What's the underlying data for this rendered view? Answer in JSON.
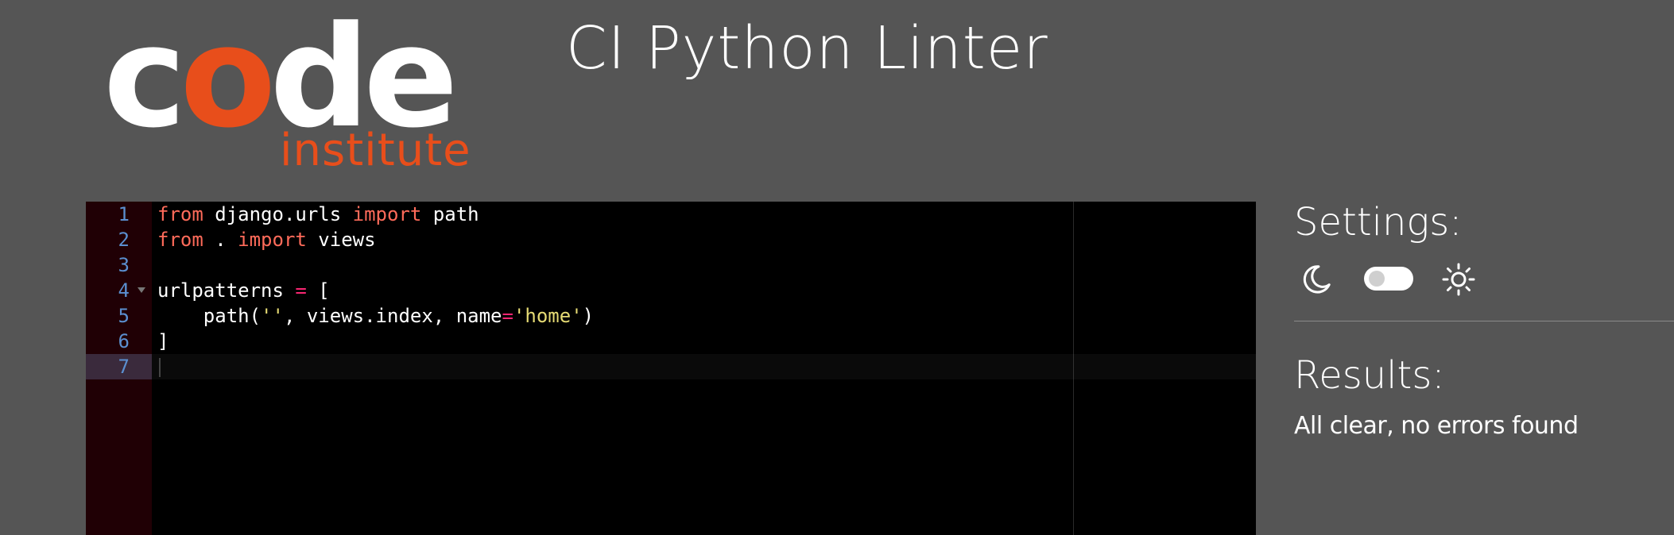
{
  "logo": {
    "code_parts": [
      "c",
      "o",
      "de"
    ],
    "subtitle": "institute",
    "colors": {
      "white": "#ffffff",
      "orange": "#e84e1b"
    }
  },
  "header": {
    "title": "CI Python Linter"
  },
  "editor": {
    "active_line": 7,
    "lines": [
      {
        "number": "1",
        "tokens": [
          {
            "t": "from",
            "c": "kw-soft"
          },
          {
            "t": " django.urls ",
            "c": ""
          },
          {
            "t": "import",
            "c": "kw-soft"
          },
          {
            "t": " path",
            "c": ""
          }
        ]
      },
      {
        "number": "2",
        "tokens": [
          {
            "t": "from",
            "c": "kw-soft"
          },
          {
            "t": " . ",
            "c": ""
          },
          {
            "t": "import",
            "c": "kw-soft"
          },
          {
            "t": " views",
            "c": ""
          }
        ]
      },
      {
        "number": "3",
        "tokens": []
      },
      {
        "number": "4",
        "fold": true,
        "tokens": [
          {
            "t": "urlpatterns ",
            "c": ""
          },
          {
            "t": "=",
            "c": "op"
          },
          {
            "t": " [",
            "c": ""
          }
        ]
      },
      {
        "number": "5",
        "tokens": [
          {
            "t": "    path(",
            "c": ""
          },
          {
            "t": "''",
            "c": "str"
          },
          {
            "t": ", views.index, name",
            "c": ""
          },
          {
            "t": "=",
            "c": "op"
          },
          {
            "t": "'home'",
            "c": "str"
          },
          {
            "t": ")",
            "c": ""
          }
        ]
      },
      {
        "number": "6",
        "tokens": [
          {
            "t": "]",
            "c": ""
          }
        ]
      },
      {
        "number": "7",
        "tokens": []
      }
    ]
  },
  "settings": {
    "heading": "Settings:",
    "dark_icon": "moon-icon",
    "light_icon": "sun-icon",
    "theme_toggle": "off"
  },
  "results": {
    "heading": "Results:",
    "message": "All clear, no errors found"
  }
}
